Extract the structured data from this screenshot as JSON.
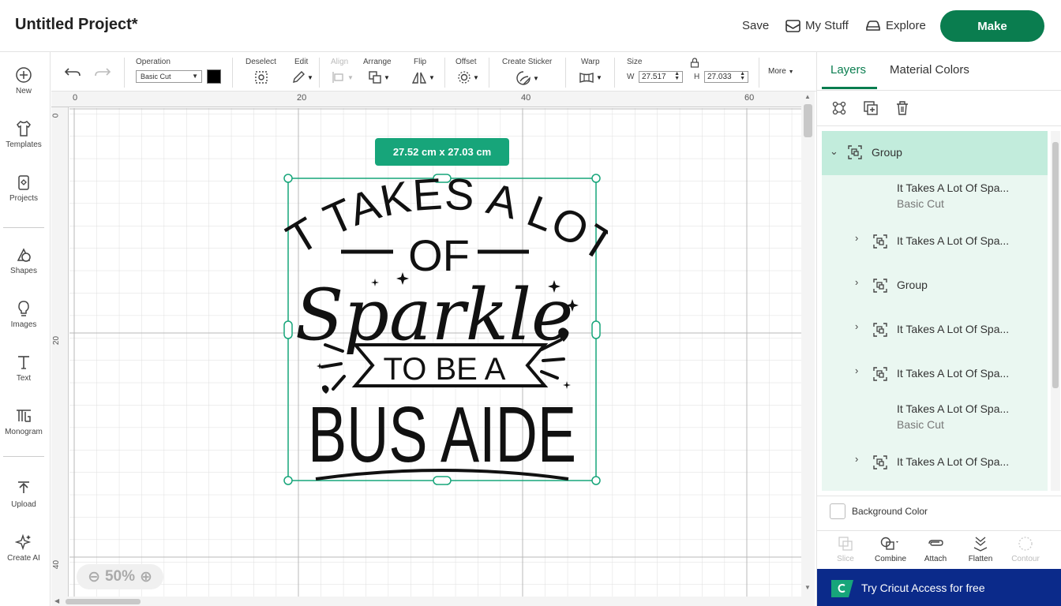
{
  "header": {
    "project_title": "Untitled Project*",
    "save": "Save",
    "my_stuff": "My Stuff",
    "explore": "Explore",
    "make": "Make"
  },
  "leftbar": {
    "items": [
      {
        "label": "New",
        "icon": "plus-circle-icon"
      },
      {
        "label": "Templates",
        "icon": "shirt-icon"
      },
      {
        "label": "Projects",
        "icon": "projects-icon"
      },
      {
        "label": "Shapes",
        "icon": "shapes-icon"
      },
      {
        "label": "Images",
        "icon": "lightbulb-icon"
      },
      {
        "label": "Text",
        "icon": "text-icon"
      },
      {
        "label": "Monogram",
        "icon": "monogram-icon"
      },
      {
        "label": "Upload",
        "icon": "upload-icon"
      },
      {
        "label": "Create AI",
        "icon": "sparkle-icon"
      }
    ]
  },
  "toolbar": {
    "operation_label": "Operation",
    "operation_value": "Basic Cut",
    "deselect": "Deselect",
    "edit": "Edit",
    "align": "Align",
    "arrange": "Arrange",
    "flip": "Flip",
    "offset": "Offset",
    "create_sticker": "Create Sticker",
    "warp": "Warp",
    "size": "Size",
    "w_label": "W",
    "w_value": "27.517",
    "h_label": "H",
    "h_value": "27.033",
    "more": "More"
  },
  "canvas": {
    "ruler_top": [
      "0",
      "20",
      "40",
      "60"
    ],
    "ruler_left": [
      "0",
      "20",
      "40"
    ],
    "size_badge": "27.52  cm x 27.03  cm",
    "zoom": "50%",
    "design_lines": [
      "IT TAKES A LOT",
      "OF",
      "Sparkle",
      "TO BE A",
      "BUS AIDE"
    ]
  },
  "panel": {
    "tab_layers": "Layers",
    "tab_material": "Material Colors",
    "layers": [
      {
        "name": "Group",
        "sub": "",
        "type": "group-head"
      },
      {
        "name": "It Takes A Lot Of Spa...",
        "sub": "Basic Cut",
        "type": "shape"
      },
      {
        "name": "It Takes A Lot Of Spa...",
        "sub": "",
        "type": "group"
      },
      {
        "name": "Group",
        "sub": "",
        "type": "group"
      },
      {
        "name": "It Takes A Lot Of Spa...",
        "sub": "",
        "type": "group"
      },
      {
        "name": "It Takes A Lot Of Spa...",
        "sub": "",
        "type": "group"
      },
      {
        "name": "It Takes A Lot Of Spa...",
        "sub": "Basic Cut",
        "type": "shape"
      },
      {
        "name": "It Takes A Lot Of Spa...",
        "sub": "",
        "type": "group"
      }
    ],
    "background_color": "Background Color",
    "actions": [
      "Slice",
      "Combine",
      "Attach",
      "Flatten",
      "Contour"
    ],
    "promo": "Try Cricut Access for free"
  },
  "colors": {
    "brand_green": "#0a7d4f",
    "badge_green": "#17a57a",
    "layer_bg": "#eaf7f1",
    "promo_blue": "#0b2a8a"
  }
}
